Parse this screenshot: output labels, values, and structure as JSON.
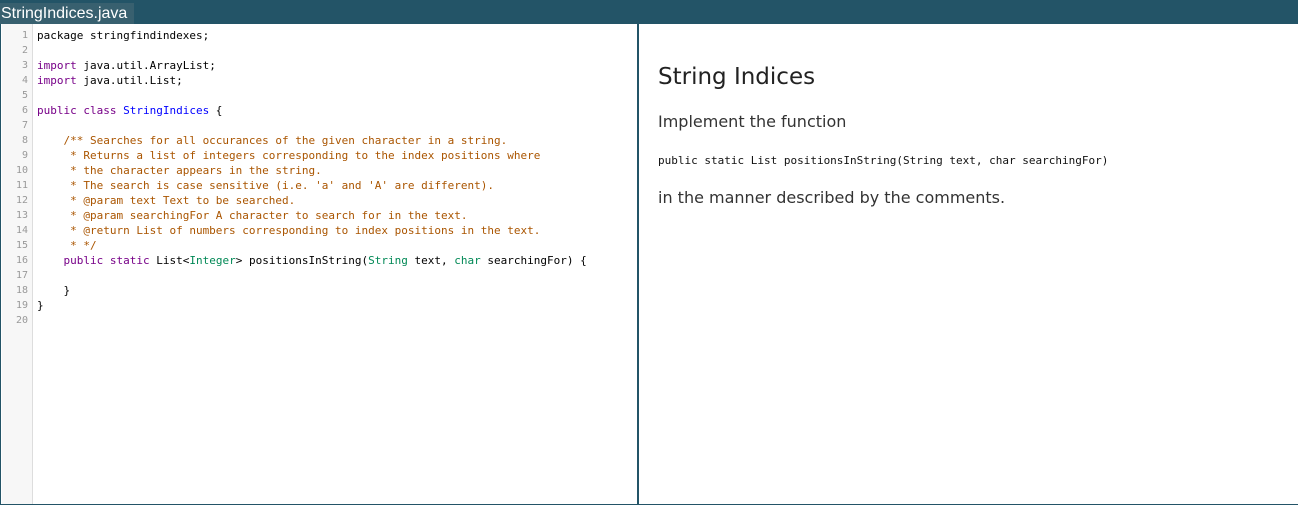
{
  "tab": {
    "filename": "StringIndices.java"
  },
  "editor": {
    "lines": [
      {
        "n": "1",
        "tokens": [
          {
            "t": "package stringfindindexes;",
            "c": "plain"
          }
        ]
      },
      {
        "n": "2",
        "tokens": []
      },
      {
        "n": "3",
        "tokens": [
          {
            "t": "import",
            "c": "keyword"
          },
          {
            "t": " java.util.ArrayList;",
            "c": "plain"
          }
        ]
      },
      {
        "n": "4",
        "tokens": [
          {
            "t": "import",
            "c": "keyword"
          },
          {
            "t": " java.util.List;",
            "c": "plain"
          }
        ]
      },
      {
        "n": "5",
        "tokens": []
      },
      {
        "n": "6",
        "tokens": [
          {
            "t": "public class ",
            "c": "keyword"
          },
          {
            "t": "StringIndices",
            "c": "def"
          },
          {
            "t": " {",
            "c": "plain"
          }
        ]
      },
      {
        "n": "7",
        "tokens": []
      },
      {
        "n": "8",
        "tokens": [
          {
            "t": "    /** Searches for all occurances of the given character in a string.",
            "c": "comment"
          }
        ]
      },
      {
        "n": "9",
        "tokens": [
          {
            "t": "     * Returns a list of integers corresponding to the index positions where",
            "c": "comment"
          }
        ]
      },
      {
        "n": "10",
        "tokens": [
          {
            "t": "     * the character appears in the string.",
            "c": "comment"
          }
        ]
      },
      {
        "n": "11",
        "tokens": [
          {
            "t": "     * The search is case sensitive (i.e. 'a' and 'A' are different).",
            "c": "comment"
          }
        ]
      },
      {
        "n": "12",
        "tokens": [
          {
            "t": "     * @param text Text to be searched.",
            "c": "comment"
          }
        ]
      },
      {
        "n": "13",
        "tokens": [
          {
            "t": "     * @param searchingFor A character to search for in the text.",
            "c": "comment"
          }
        ]
      },
      {
        "n": "14",
        "tokens": [
          {
            "t": "     * @return List of numbers corresponding to index positions in the text.",
            "c": "comment"
          }
        ]
      },
      {
        "n": "15",
        "tokens": [
          {
            "t": "     * */",
            "c": "comment"
          }
        ]
      },
      {
        "n": "16",
        "tokens": [
          {
            "t": "    public static ",
            "c": "keyword"
          },
          {
            "t": "List<",
            "c": "plain"
          },
          {
            "t": "Integer",
            "c": "type"
          },
          {
            "t": "> positionsInString(",
            "c": "plain"
          },
          {
            "t": "String",
            "c": "type"
          },
          {
            "t": " text, ",
            "c": "plain"
          },
          {
            "t": "char",
            "c": "type"
          },
          {
            "t": " searchingFor) {",
            "c": "plain"
          }
        ]
      },
      {
        "n": "17",
        "tokens": []
      },
      {
        "n": "18",
        "tokens": [
          {
            "t": "    }",
            "c": "plain"
          }
        ]
      },
      {
        "n": "19",
        "tokens": [
          {
            "t": "}",
            "c": "plain"
          }
        ]
      },
      {
        "n": "20",
        "tokens": []
      }
    ]
  },
  "instructions": {
    "title": "String Indices",
    "intro": "Implement the function",
    "signature": "public static List positionsInString(String text, char searchingFor)",
    "outro": "in the manner described by the comments."
  },
  "colors": {
    "header": "#235467",
    "keyword": "#770088",
    "def": "#0000ff",
    "type": "#008855",
    "comment": "#aa5500"
  }
}
